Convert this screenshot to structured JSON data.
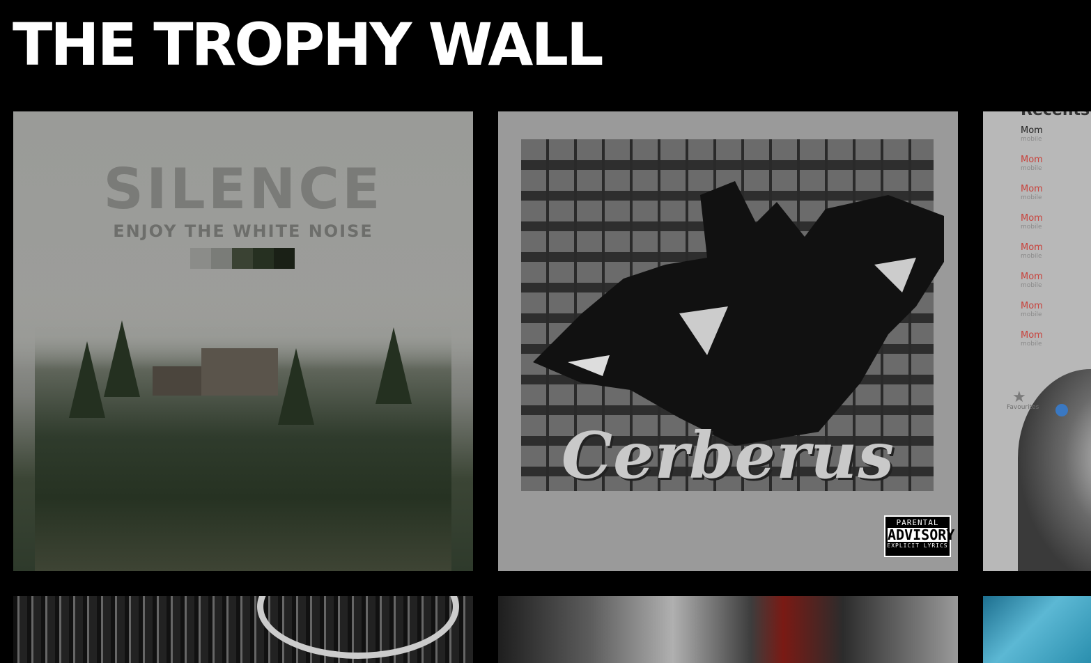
{
  "header": {
    "title": "THE TROPHY WALL"
  },
  "albums": [
    {
      "title": "SILENCE",
      "subtitle": "ENJOY THE WHITE NOISE",
      "swatches": [
        "#8b8c89",
        "#7a7c78",
        "#3a4233",
        "#263021",
        "#1a2016",
        "#0f120d"
      ]
    },
    {
      "title": "Cerberus",
      "advisory": {
        "line1": "PARENTAL",
        "line2": "ADVISORY",
        "line3": "EXPLICIT LYRICS"
      }
    },
    {
      "recents_title": "Recents",
      "contacts": [
        {
          "name": "Mom",
          "sub": "mobile"
        },
        {
          "name": "Mom",
          "sub": "mobile"
        },
        {
          "name": "Mom",
          "sub": "mobile"
        },
        {
          "name": "Mom",
          "sub": "mobile"
        },
        {
          "name": "Mom",
          "sub": "mobile"
        },
        {
          "name": "Mom",
          "sub": "mobile"
        },
        {
          "name": "Mom",
          "sub": "mobile"
        },
        {
          "name": "Mom",
          "sub": "mobile"
        }
      ],
      "favourites_label": "Favourites"
    }
  ],
  "colors": {
    "background": "#000000",
    "title": "#ffffff",
    "recents_red": "#c8423c"
  }
}
